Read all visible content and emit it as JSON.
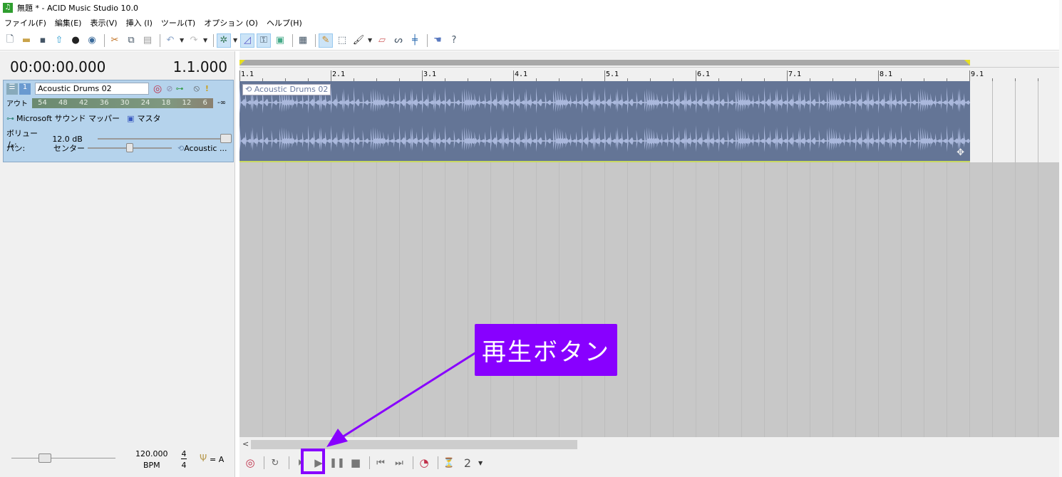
{
  "window": {
    "title": "無題 * - ACID Music Studio 10.0",
    "app_icon_glyph": "♫"
  },
  "menu": [
    "ファイル(F)",
    "編集(E)",
    "表示(V)",
    "挿入 (I)",
    "ツール(T)",
    "オプション (O)",
    "ヘルプ(H)"
  ],
  "toolbar": {
    "groups": [
      [
        "new-icon",
        "open-icon",
        "save-icon",
        "publish-icon",
        "user-icon",
        "cd-icon"
      ],
      [
        "cut-icon",
        "copy-icon",
        "paste-icon"
      ],
      [
        "undo-icon",
        "redo-icon"
      ],
      [
        "draw-tool-icon",
        "envelope-tool-icon",
        "lock-envelopes-icon",
        "auto-crossfade-icon"
      ],
      [
        "grid-icon"
      ],
      [
        "pencil-icon",
        "selection-icon",
        "paint-icon",
        "erase-icon",
        "envelope-icon",
        "split-icon"
      ],
      [
        "hand-icon",
        "help-icon"
      ]
    ],
    "active_tool": "pencil-icon"
  },
  "time_display": {
    "time": "00:00:00.000",
    "measure": "1.1.000"
  },
  "track": {
    "name": "Acoustic Drums 02",
    "out_label": "アウト",
    "meter_ticks": [
      "54",
      "48",
      "42",
      "36",
      "30",
      "24",
      "18",
      "12",
      "6"
    ],
    "meter_value": "-∞",
    "device": "Microsoft サウンド マッパー",
    "bus": "マスタ",
    "volume_label": "ボリューム:",
    "volume_value": "12.0 dB",
    "volume_fraction": 1.0,
    "pan_label": "パン:",
    "pan_value": "センター",
    "pan_fraction": 0.5,
    "clip_short": "Acoustic ..."
  },
  "tempo": {
    "bpm": "120.000",
    "bpm_unit": "BPM",
    "time_sig_top": "4",
    "time_sig_bottom": "4",
    "key": "= A",
    "slider_fraction": 0.3
  },
  "ruler": {
    "labels": [
      "1.1",
      "2.1",
      "3.1",
      "4.1",
      "5.1",
      "6.1",
      "7.1",
      "8.1",
      "9.1"
    ]
  },
  "clip": {
    "label": "Acoustic Drums 02"
  },
  "transport": {
    "buttons": [
      "record",
      "loop",
      "play-from-start",
      "play",
      "pause",
      "stop",
      "go-to-start",
      "go-to-end",
      "record-arm",
      "metronome",
      "count-in"
    ],
    "count_in_value": "2"
  },
  "annotation": {
    "callout_text": "再生ボタン",
    "color": "#8800ff"
  },
  "hscroll_left": "<"
}
